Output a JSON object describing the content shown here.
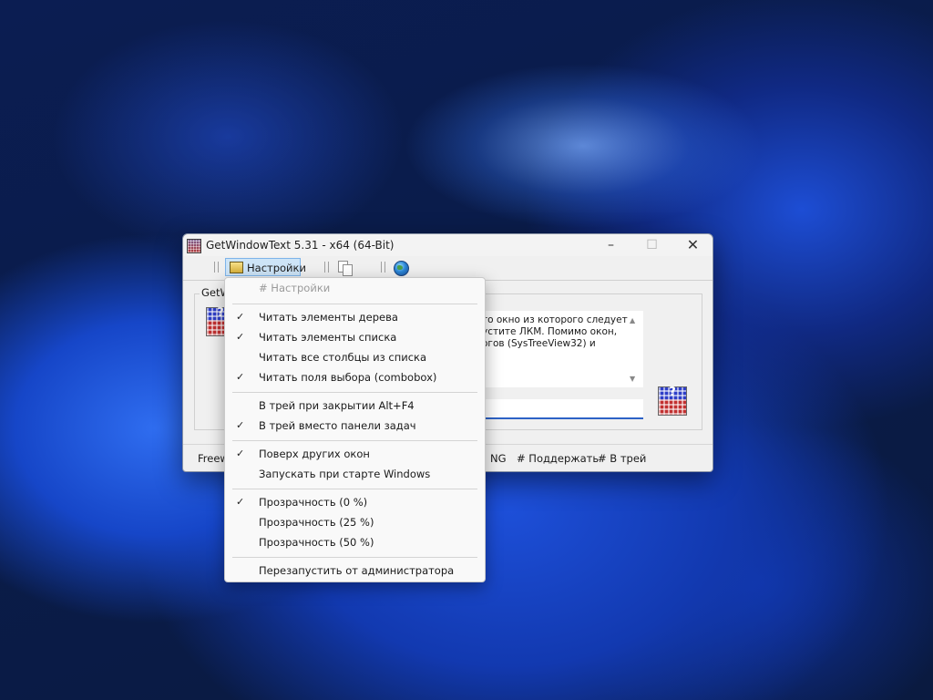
{
  "window": {
    "title": "GetWindowText 5.31 - x64 (64-Bit)",
    "controls": {
      "minimize": "–",
      "maximize": "☐",
      "close": "✕"
    }
  },
  "toolbar": {
    "settings_label": "Настройки",
    "icons": [
      "settings-icon",
      "copy-icon",
      "globe-icon"
    ]
  },
  "main": {
    "group_label": "GetW",
    "description_lines": [
      "то окно из которого следует",
      "устите ЛКМ. Помимо окон,",
      "огов (SysTreeView32) и"
    ]
  },
  "statusbar": {
    "left": "Freew",
    "lang": "NG",
    "support": "# Поддержать",
    "tray": "# В трей"
  },
  "menu": {
    "header": "# Настройки",
    "items": [
      {
        "label": "Читать элементы дерева",
        "checked": true
      },
      {
        "label": "Читать элементы списка",
        "checked": true
      },
      {
        "label": "Читать все столбцы из списка",
        "checked": false
      },
      {
        "label": "Читать поля выбора (combobox)",
        "checked": true
      },
      {
        "label": "В трей при закрытии Alt+F4",
        "checked": false
      },
      {
        "label": "В трей вместо панели задач",
        "checked": true
      },
      {
        "label": "Поверх других окон",
        "checked": true
      },
      {
        "label": "Запускать при старте Windows",
        "checked": false
      },
      {
        "label": "Прозрачность (0 %)",
        "checked": true
      },
      {
        "label": "Прозрачность (25 %)",
        "checked": false
      },
      {
        "label": "Прозрачность (50 %)",
        "checked": false
      },
      {
        "label": "Перезапустить от администратора",
        "checked": false
      }
    ],
    "check_glyph": "✓"
  }
}
